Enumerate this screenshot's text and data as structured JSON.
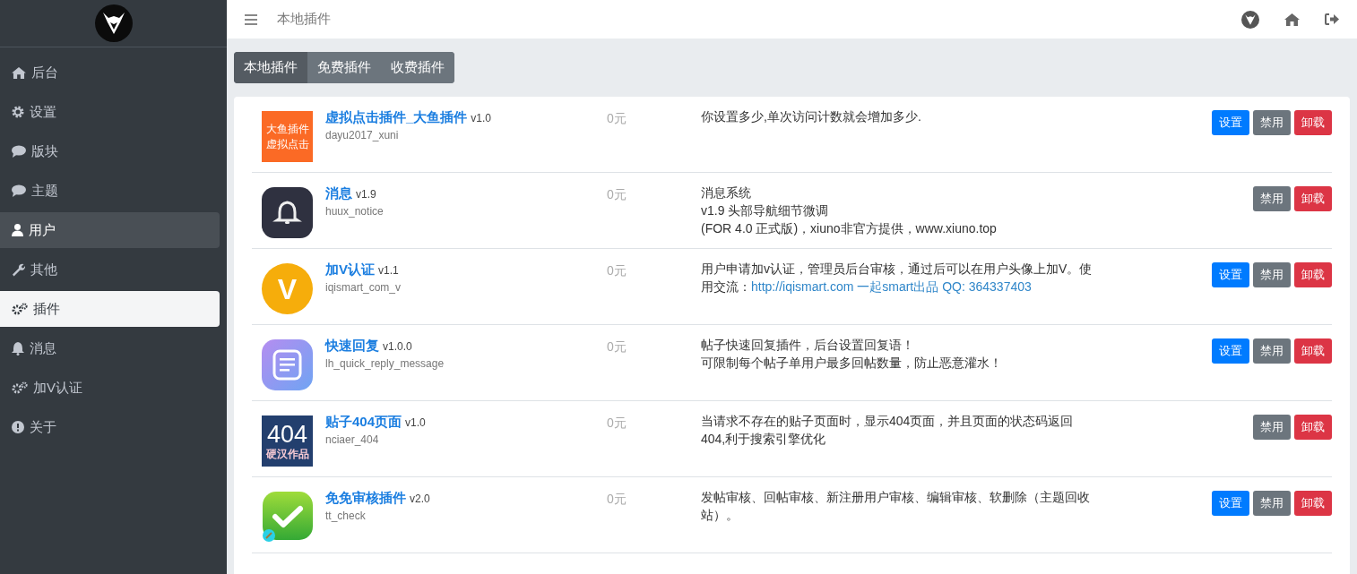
{
  "sidebar": {
    "items": [
      {
        "label": "后台",
        "selected": false,
        "highlighted": false
      },
      {
        "label": "设置",
        "selected": false,
        "highlighted": false
      },
      {
        "label": "版块",
        "selected": false,
        "highlighted": false
      },
      {
        "label": "主题",
        "selected": false,
        "highlighted": false
      },
      {
        "label": "用户",
        "selected": false,
        "highlighted": true
      },
      {
        "label": "其他",
        "selected": false,
        "highlighted": false
      },
      {
        "label": "插件",
        "selected": true,
        "highlighted": false
      },
      {
        "label": "消息",
        "selected": false,
        "highlighted": false
      },
      {
        "label": "加V认证",
        "selected": false,
        "highlighted": false
      },
      {
        "label": "关于",
        "selected": false,
        "highlighted": false
      }
    ]
  },
  "topbar": {
    "title": "本地插件"
  },
  "tabs": [
    {
      "label": "本地插件",
      "selected": true
    },
    {
      "label": "免费插件",
      "selected": false
    },
    {
      "label": "收费插件",
      "selected": false
    }
  ],
  "plugins": [
    {
      "icon": {
        "kind": "text-tile",
        "lines": [
          "大鱼插件",
          "虚拟点击"
        ]
      },
      "name": "虚拟点击插件_大鱼插件",
      "version": "v1.0",
      "slug": "dayu2017_xuni",
      "price": "0元",
      "description": [
        "你设置多少,单次访问计数就会增加多少."
      ],
      "buttons": [
        {
          "kind": "settings",
          "label": "设置"
        },
        {
          "kind": "disable",
          "label": "禁用"
        },
        {
          "kind": "uninstall",
          "label": "卸载"
        }
      ]
    },
    {
      "icon": {
        "kind": "bell"
      },
      "name": "消息",
      "version": "v1.9",
      "slug": "huux_notice",
      "price": "0元",
      "description": [
        "消息系统",
        "v1.9 头部导航细节微调",
        "(FOR 4.0 正式版)，xiuno非官方提供，www.xiuno.top"
      ],
      "buttons": [
        {
          "kind": "disable",
          "label": "禁用"
        },
        {
          "kind": "uninstall",
          "label": "卸载"
        }
      ]
    },
    {
      "icon": {
        "kind": "letter",
        "lines": [
          "V"
        ]
      },
      "name": "加V认证",
      "version": "v1.1",
      "slug": "iqismart_com_v",
      "price": "0元",
      "description": [
        "用户申请加v认证，管理员后台审核，通过后可以在用户头像上加V。使用交流："
      ],
      "link": "http://iqismart.com 一起smart出品 QQ: 364337403",
      "buttons": [
        {
          "kind": "settings",
          "label": "设置"
        },
        {
          "kind": "disable",
          "label": "禁用"
        },
        {
          "kind": "uninstall",
          "label": "卸载"
        }
      ]
    },
    {
      "icon": {
        "kind": "note"
      },
      "name": "快速回复",
      "version": "v1.0.0",
      "slug": "lh_quick_reply_message",
      "price": "0元",
      "description": [
        "帖子快速回复插件，后台设置回复语！",
        "可限制每个帖子单用户最多回帖数量，防止恶意灌水！"
      ],
      "buttons": [
        {
          "kind": "settings",
          "label": "设置"
        },
        {
          "kind": "disable",
          "label": "禁用"
        },
        {
          "kind": "uninstall",
          "label": "卸载"
        }
      ]
    },
    {
      "icon": {
        "kind": "banner",
        "lines": [
          "404",
          "硬汉作品"
        ]
      },
      "name": "贴子404页面",
      "version": "v1.0",
      "slug": "nciaer_404",
      "price": "0元",
      "description": [
        "当请求不存在的贴子页面时，显示404页面，并且页面的状态码返回404,利于搜索引擎优化"
      ],
      "buttons": [
        {
          "kind": "disable",
          "label": "禁用"
        },
        {
          "kind": "uninstall",
          "label": "卸载"
        }
      ]
    },
    {
      "icon": {
        "kind": "check"
      },
      "name": "免免审核插件",
      "version": "v2.0",
      "slug": "tt_check",
      "price": "0元",
      "description": [
        "发帖审核、回帖审核、新注册用户审核、编辑审核、软删除（主题回收站）。"
      ],
      "buttons": [
        {
          "kind": "settings",
          "label": "设置"
        },
        {
          "kind": "disable",
          "label": "禁用"
        },
        {
          "kind": "uninstall",
          "label": "卸载"
        }
      ]
    }
  ]
}
